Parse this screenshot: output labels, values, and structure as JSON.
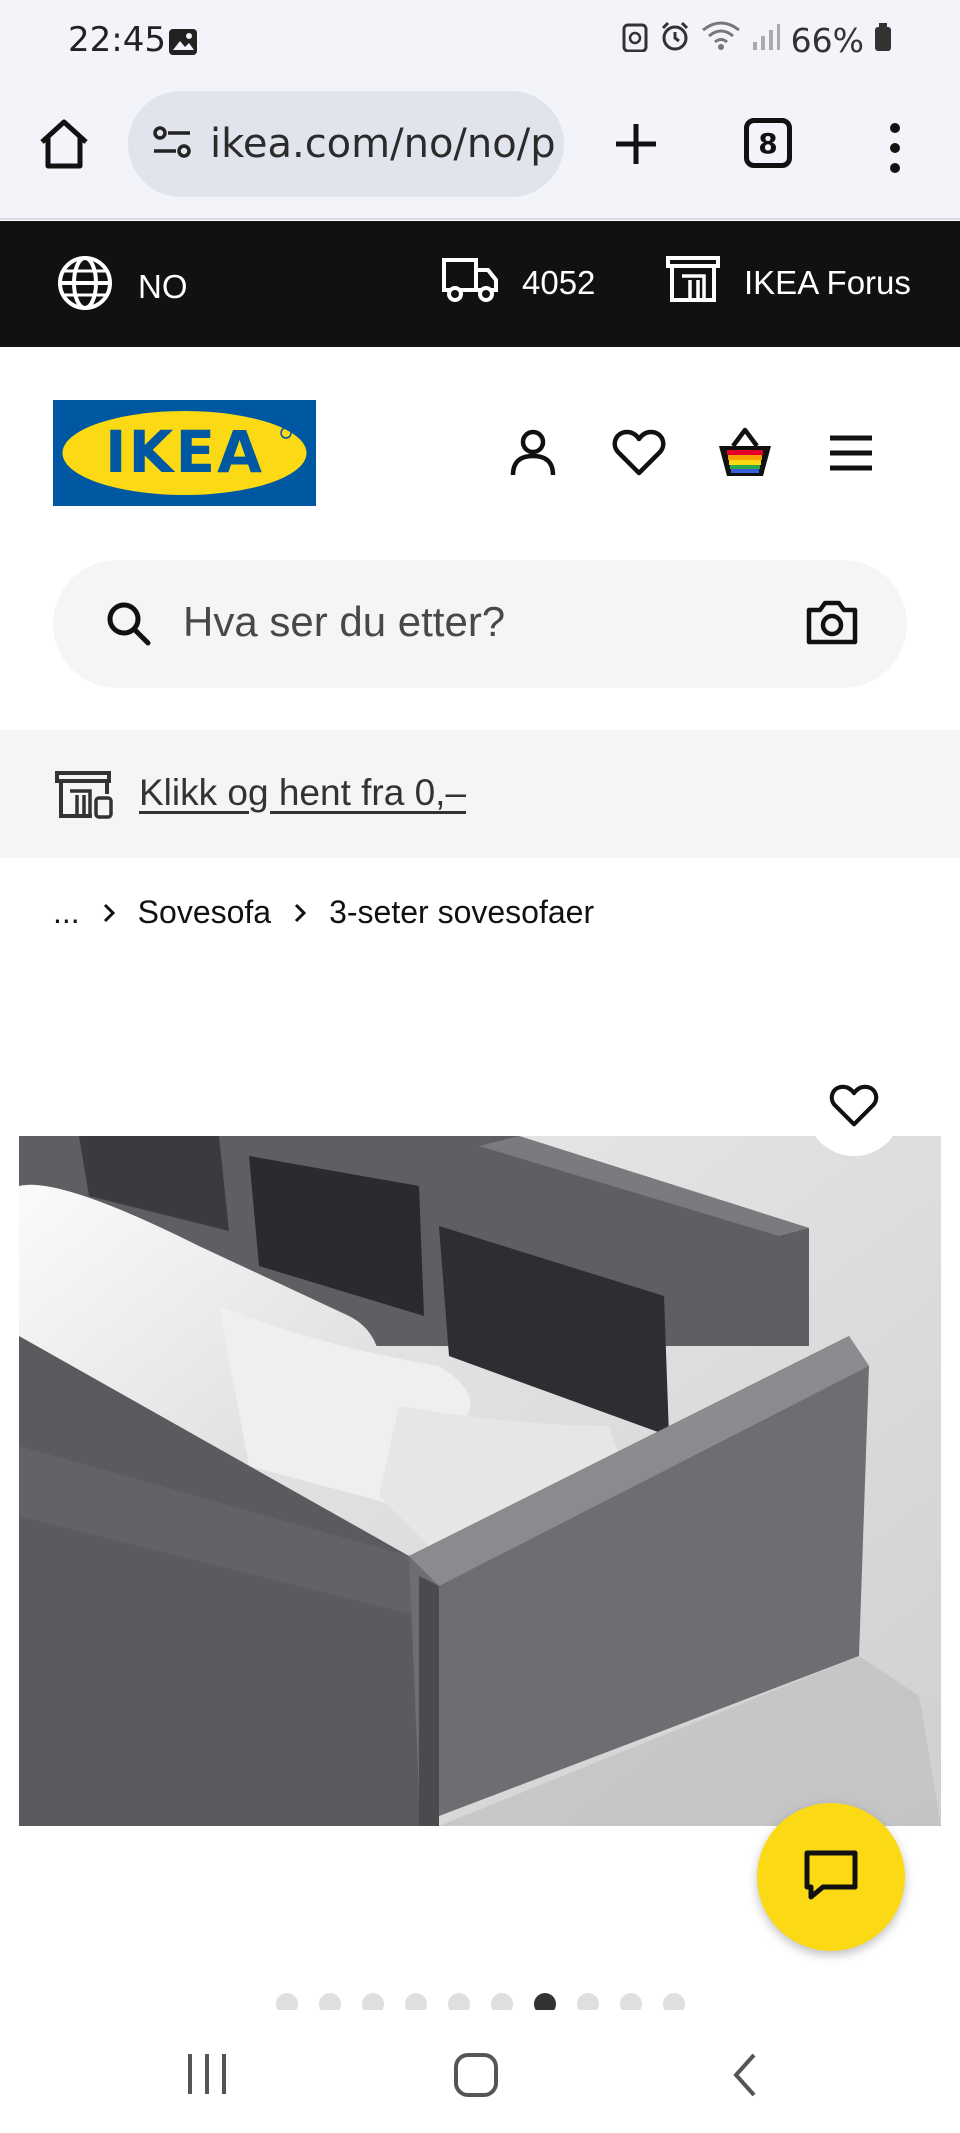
{
  "status_bar": {
    "time": "22:45",
    "battery": "66%",
    "icons": [
      "gallery-icon",
      "recycle-icon",
      "alarm-icon",
      "wifi-icon",
      "signal-icon",
      "battery-icon"
    ]
  },
  "browser": {
    "url": "ikea.com/no/no/p",
    "tab_count": "8",
    "icons": [
      "home-icon",
      "site-settings-icon",
      "plus-icon",
      "more-vertical-icon"
    ]
  },
  "top_bar": {
    "language": "NO",
    "postal_code": "4052",
    "store": "IKEA Forus"
  },
  "header": {
    "logo_text": "IKEA",
    "icons": [
      "account-icon",
      "heart-icon",
      "shopping-bag-icon",
      "menu-icon"
    ]
  },
  "search": {
    "placeholder": "Hva ser du etter?"
  },
  "promo": {
    "link_text": "Klikk og hent fra 0,–"
  },
  "breadcrumb": {
    "items": [
      "...",
      "Sovesofa",
      "3-seter sovesofaer"
    ]
  },
  "product": {
    "image_count": 10,
    "active_image_index": 6
  },
  "colors": {
    "ikea_blue": "#0058a3",
    "ikea_yellow": "#fbd914",
    "top_bar_bg": "#111111"
  }
}
